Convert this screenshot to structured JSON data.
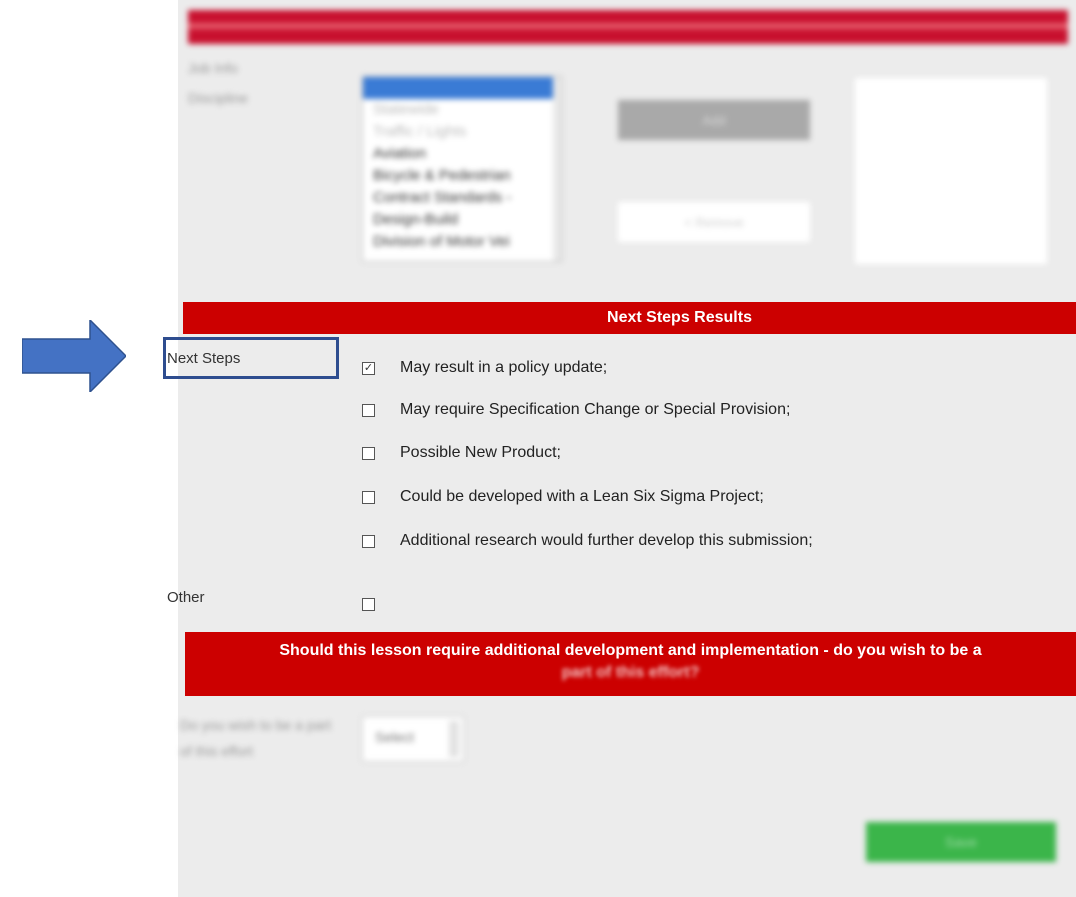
{
  "top_section": {
    "label_1": "Job Info",
    "label_2": "Discipline",
    "list_options": [
      "Statewide",
      "Traffic / Lights",
      "Aviation",
      "Bicycle & Pedestrian",
      "Contract Standards -",
      "Design-Build",
      "Division of Motor Vei"
    ],
    "add_button": "Add",
    "remove_button": "< Remove"
  },
  "next_steps": {
    "header": "Next Steps Results",
    "label": "Next Steps",
    "options": [
      {
        "label": "May result in a policy update;",
        "checked": true
      },
      {
        "label": "May require Specification Change or Special Provision;",
        "checked": false
      },
      {
        "label": "Possible New Product;",
        "checked": false
      },
      {
        "label": "Could be developed with a Lean Six Sigma Project;",
        "checked": false
      },
      {
        "label": "Additional research would further develop this submission;",
        "checked": false
      }
    ],
    "other_label": "Other"
  },
  "participation": {
    "banner_line1": "Should this lesson require additional development and implementation - do you wish to be a",
    "banner_line2": "part of this effort?",
    "question": "Do you wish to be a part of this effort",
    "select_value": "Select"
  },
  "submit_button": "Save",
  "colors": {
    "header_red": "#cc0000",
    "highlight_blue": "#2e4d8f",
    "arrow_blue": "#4472c4",
    "submit_green": "#3bb54a"
  }
}
